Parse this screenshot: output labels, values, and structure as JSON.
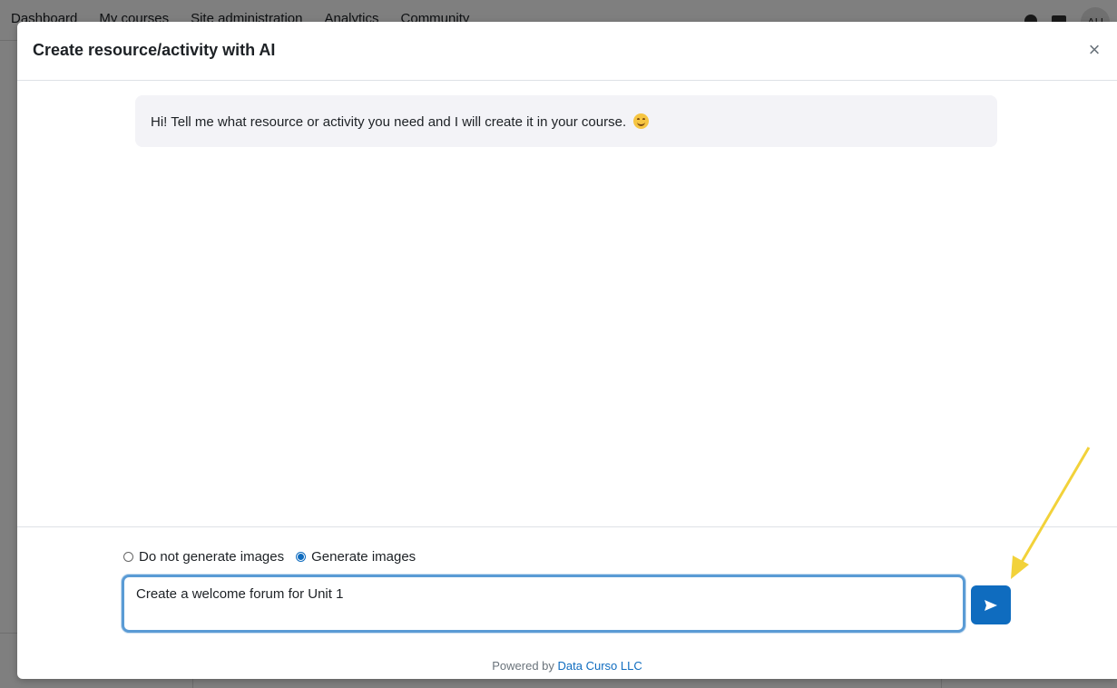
{
  "background_page": {
    "nav_items": [
      "Dashboard",
      "My courses",
      "Site administration",
      "Analytics",
      "Community"
    ],
    "avatar_initials": "AU"
  },
  "modal": {
    "title": "Create resource/activity with AI",
    "close_symbol": "×",
    "bot_message": "Hi! Tell me what resource or activity you need and I will create it in your course.",
    "bot_emoji": "smiling-face-icon",
    "image_options": [
      {
        "label": "Do not generate images",
        "selected": false
      },
      {
        "label": "Generate images",
        "selected": true
      }
    ],
    "prompt_value": "Create a welcome forum for Unit 1",
    "send_icon": "send-arrow-icon",
    "footer_prefix": "Powered by",
    "footer_link": "Data Curso LLC"
  },
  "colors": {
    "accent": "#0f6cbf",
    "focus_border": "#5a9bd5",
    "bubble_bg": "#f3f3f7",
    "annotation_arrow": "#f2d23a"
  }
}
